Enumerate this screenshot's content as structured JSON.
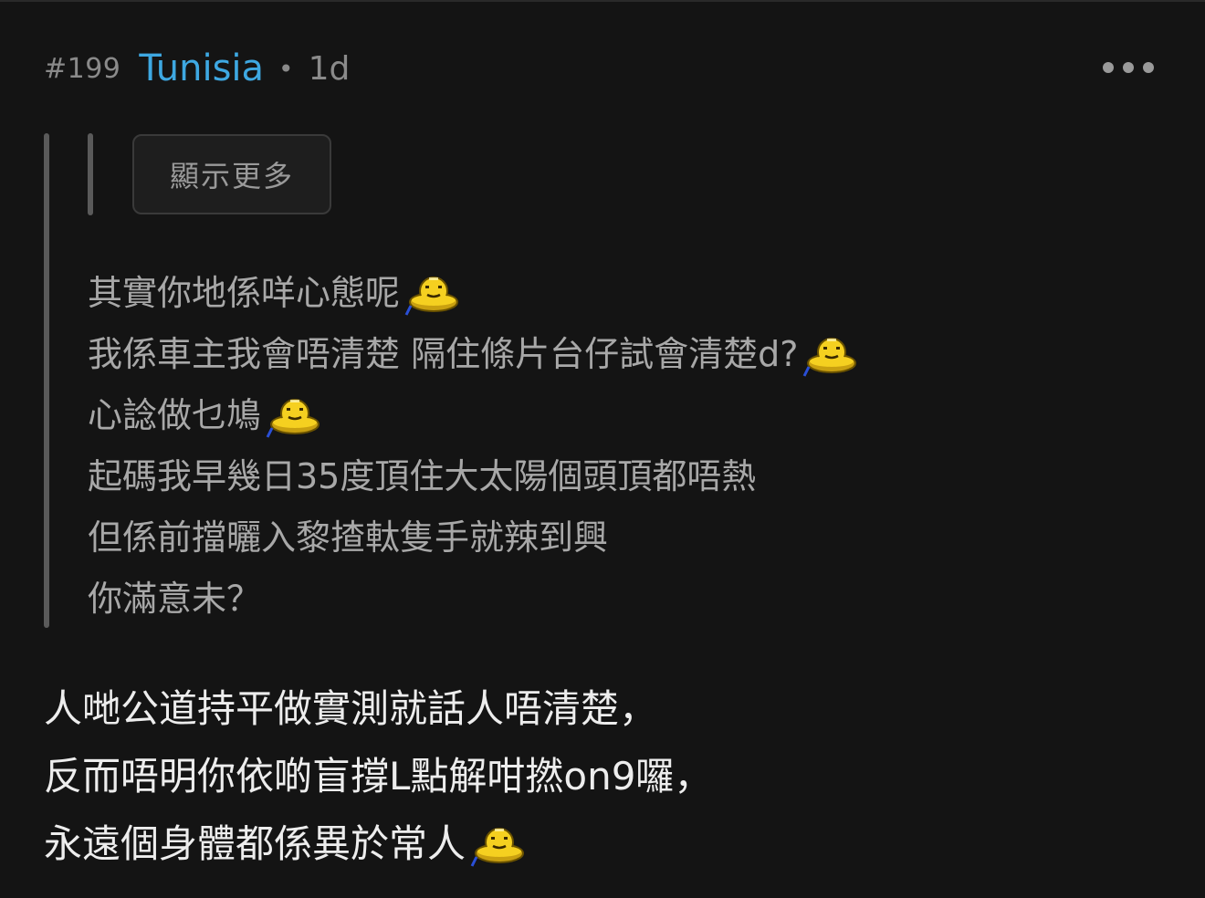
{
  "post": {
    "index": "#199",
    "username": "Tunisia",
    "separator": "•",
    "time": "1d",
    "more_icon": "ellipsis-icon"
  },
  "quote": {
    "show_more_label": "顯示更多",
    "lines": [
      {
        "text": "其實你地係咩心態呢",
        "emoji": "ufo-smiley-icon"
      },
      {
        "text": "我係車主我會唔清楚 隔住條片台仔試會清楚d?",
        "emoji": "ufo-smiley-icon"
      },
      {
        "text": "心諗做乜鳩",
        "emoji": "ufo-smiley-icon"
      },
      {
        "text": "起碼我早幾日35度頂住大太陽個頭頂都唔熱",
        "emoji": ""
      },
      {
        "text": "但係前擋曬入黎揸軚隻手就辣到興",
        "emoji": ""
      },
      {
        "text": "你滿意未？",
        "emoji": ""
      }
    ]
  },
  "reply": {
    "lines": [
      {
        "text": "人哋公道持平做實測就話人唔清楚，",
        "emoji": ""
      },
      {
        "text": "反而唔明你依啲盲撐L點解咁撚on9囉，",
        "emoji": ""
      },
      {
        "text": "永遠個身體都係異於常人",
        "emoji": "ufo-smiley-icon"
      }
    ]
  },
  "colors": {
    "background": "#141414",
    "username": "#3ea8e2",
    "muted": "#8a8a8a",
    "quote_text": "#a8a8a8",
    "reply_text": "#ededed",
    "emoji_yellow": "#f5d020"
  }
}
